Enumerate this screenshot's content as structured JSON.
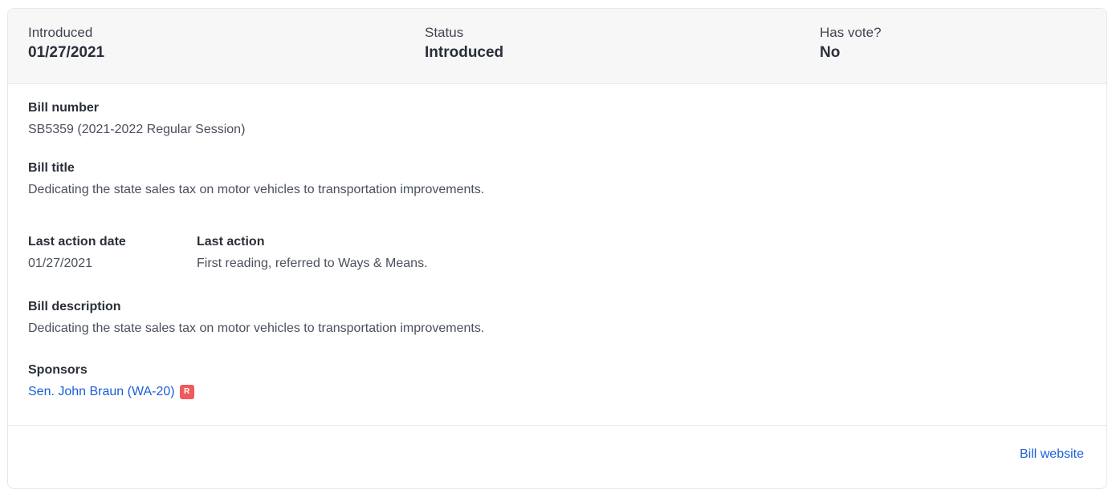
{
  "summary": {
    "introduced_label": "Introduced",
    "introduced_value": "01/27/2021",
    "status_label": "Status",
    "status_value": "Introduced",
    "vote_label": "Has vote?",
    "vote_value": "No"
  },
  "bill": {
    "number_label": "Bill number",
    "number_value": "SB5359 (2021-2022 Regular Session)",
    "title_label": "Bill title",
    "title_value": "Dedicating the state sales tax on motor vehicles to transportation improvements.",
    "last_action_date_label": "Last action date",
    "last_action_date_value": "01/27/2021",
    "last_action_label": "Last action",
    "last_action_value": "First reading, referred to Ways & Means.",
    "description_label": "Bill description",
    "description_value": "Dedicating the state sales tax on motor vehicles to transportation improvements.",
    "sponsors_label": "Sponsors",
    "sponsors": [
      {
        "name": "Sen. John Braun (WA-20)",
        "party": "R",
        "party_color": "#f05a5a"
      }
    ]
  },
  "footer": {
    "website_label": "Bill website"
  },
  "colors": {
    "link": "#1a5fd6",
    "summary_bg": "#f7f7f8",
    "border": "#e6e8eb"
  }
}
